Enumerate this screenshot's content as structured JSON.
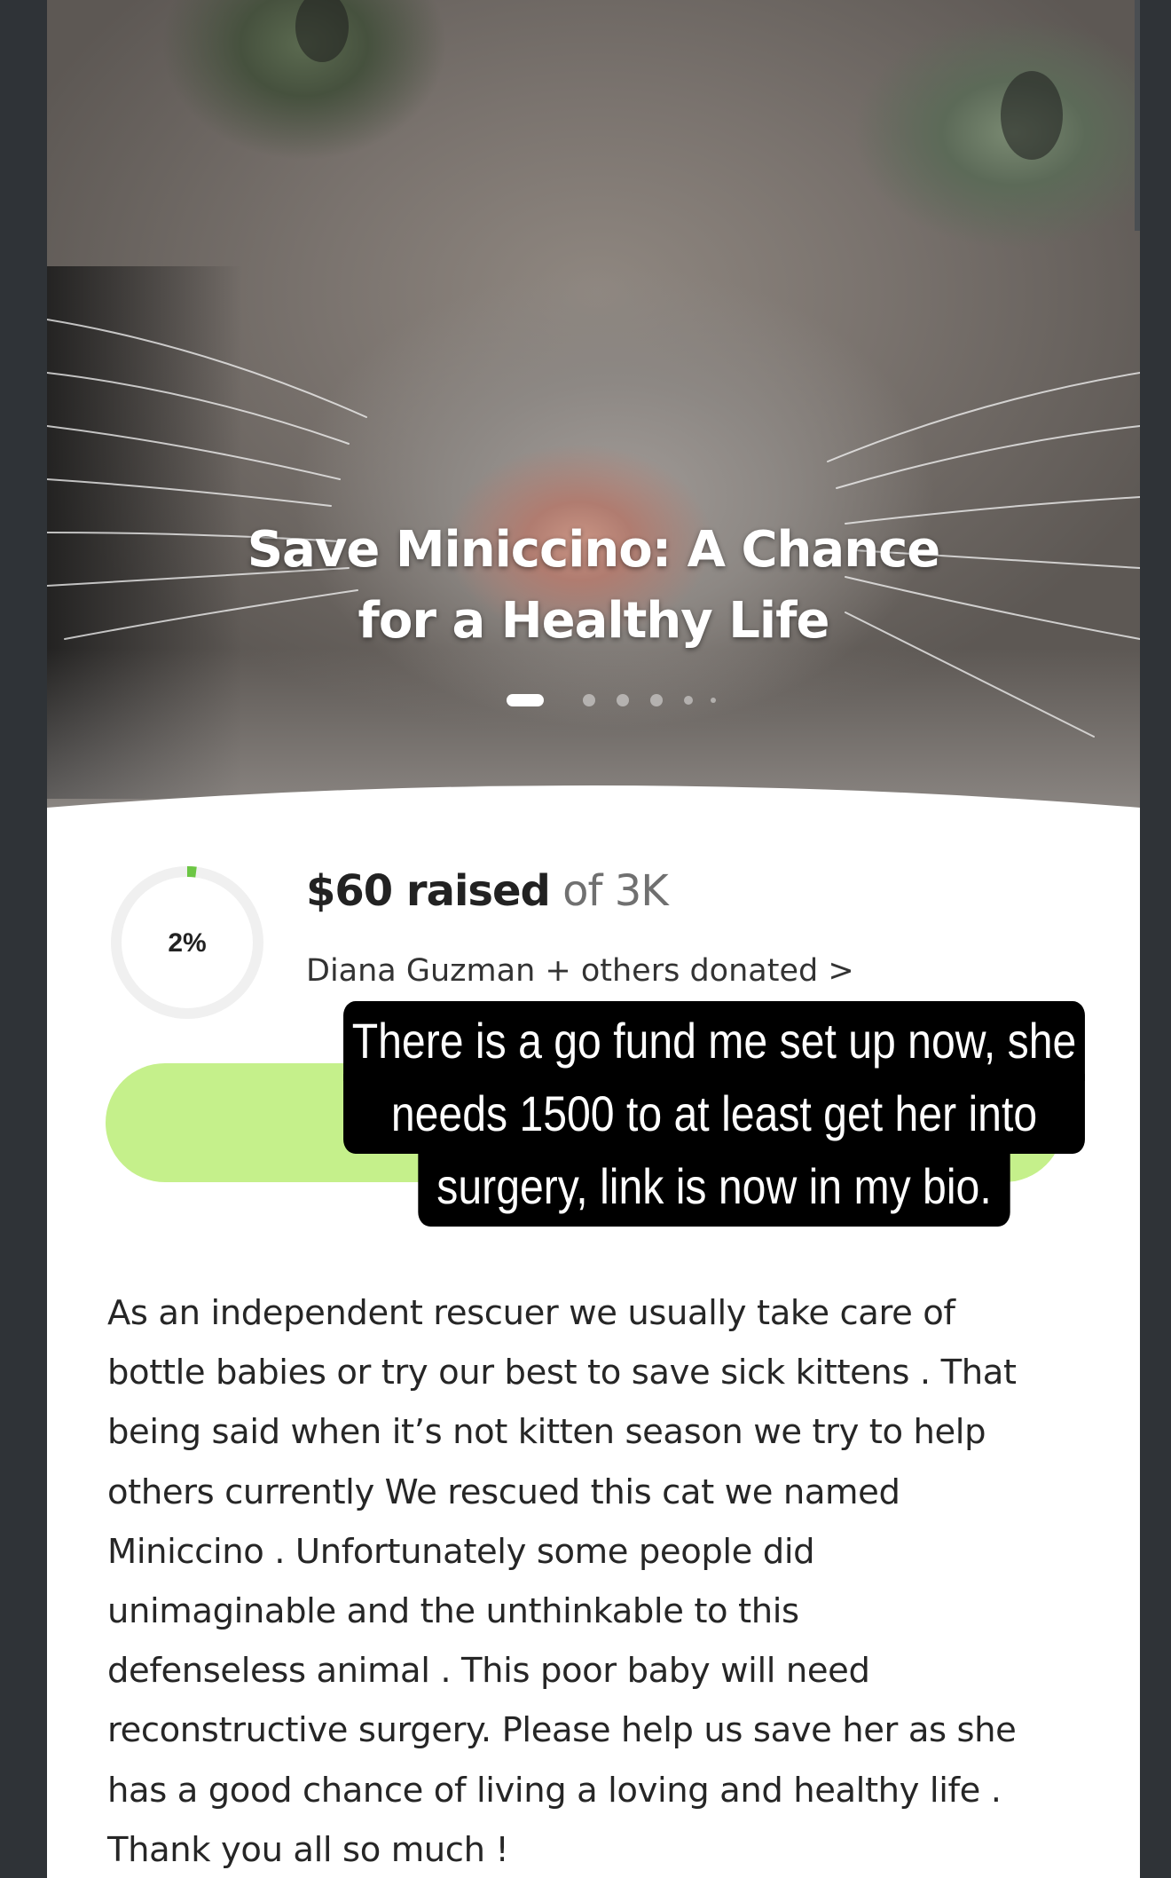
{
  "campaign": {
    "title_lines": [
      "Save Miniccino: A Chance",
      "for a Healthy Life"
    ],
    "carousel": {
      "count": 6,
      "active_index": 0
    },
    "progress_percent_label": "2%",
    "progress_fraction": 0.02,
    "raised_amount": "$60 raised",
    "goal_text": "of 3K",
    "donors_text": "Diana Guzman + others donated >",
    "accent_color": "#c5f08b",
    "ring_color": "#6cc644"
  },
  "caption": {
    "lines": [
      "There is a go fund me set up now, she",
      "needs 1500 to at least get her into",
      "surgery, link is now in my bio."
    ]
  },
  "story": {
    "lines": [
      "As an independent rescuer we usually take care of",
      "bottle babies or try our best to save sick kittens . That",
      "being said when it’s not kitten season we try to help",
      "others currently We rescued this cat we named",
      "Miniccino . Unfortunately some people did",
      "unimaginable and the unthinkable to this",
      "defenseless animal . This poor baby will need",
      "reconstructive surgery. Please help us save her as she",
      "has a good chance of living a loving and healthy life .",
      "Thank you all so much !"
    ]
  }
}
